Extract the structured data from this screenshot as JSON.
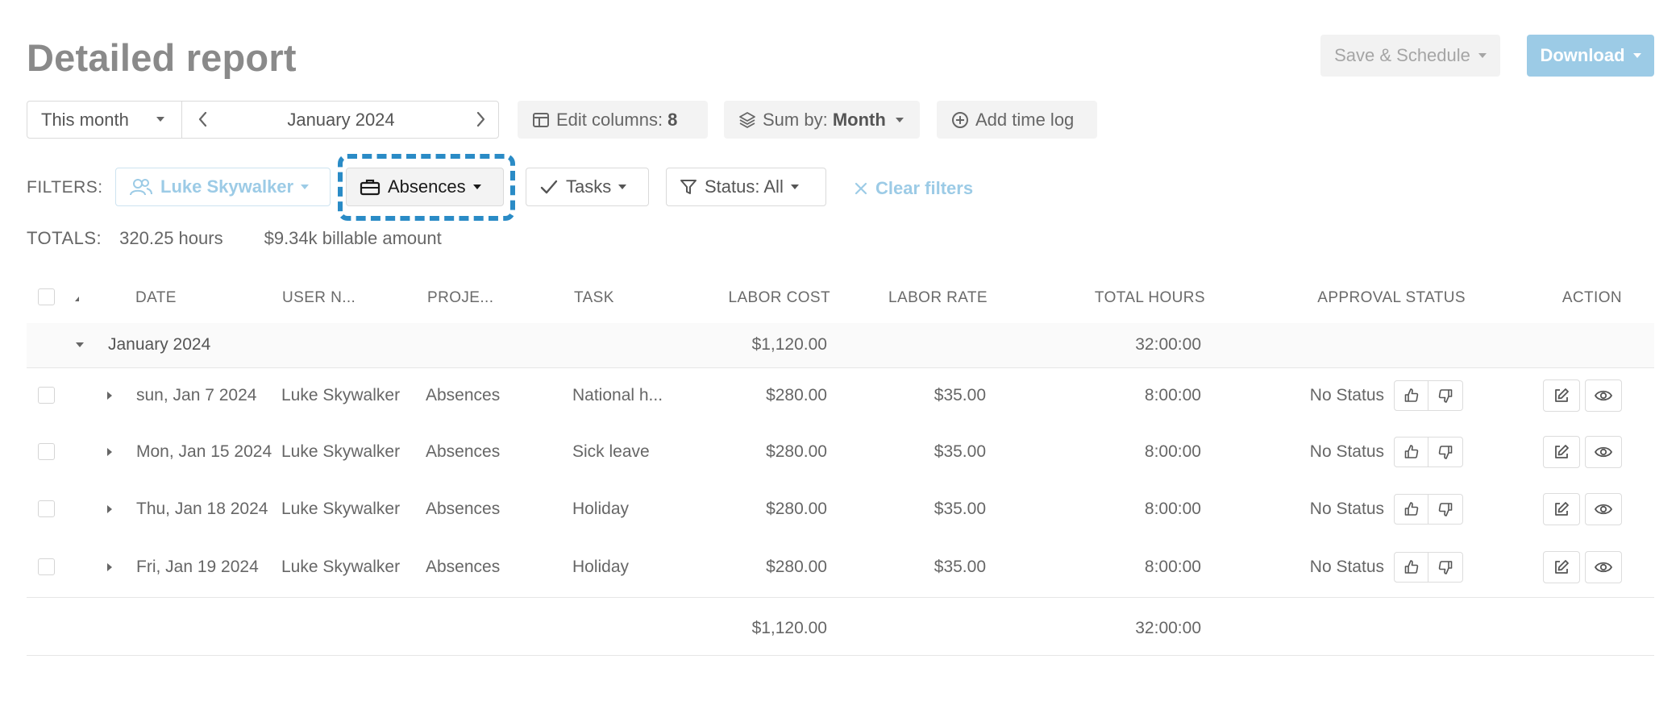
{
  "header": {
    "title": "Detailed report",
    "save_schedule_label": "Save & Schedule",
    "download_label": "Download"
  },
  "toolbar": {
    "range_label": "This month",
    "current_period": "January 2024",
    "edit_columns_prefix": "Edit columns: ",
    "edit_columns_count": "8",
    "sum_by_prefix": "Sum by: ",
    "sum_by_value": "Month",
    "add_time_log_label": "Add time log"
  },
  "filters": {
    "label": "FILTERS:",
    "user": "Luke Skywalker",
    "project": "Absences",
    "tasks": "Tasks",
    "status": "Status: All",
    "clear": "Clear filters"
  },
  "totals": {
    "label": "TOTALS:",
    "hours": "320.25 hours",
    "billable": "$9.34k billable amount"
  },
  "table": {
    "columns": [
      "DATE",
      "USER N...",
      "PROJE...",
      "TASK",
      "LABOR COST",
      "LABOR RATE",
      "TOTAL HOURS",
      "APPROVAL STATUS",
      "ACTION"
    ],
    "group": {
      "label": "January 2024",
      "labor_cost": "$1,120.00",
      "total_hours": "32:00:00"
    },
    "rows": [
      {
        "date": "sun, Jan 7 2024",
        "user": "Luke Skywalker",
        "project": "Absences",
        "task": "National h...",
        "labor_cost": "$280.00",
        "labor_rate": "$35.00",
        "total_hours": "8:00:00",
        "status": "No Status"
      },
      {
        "date": "Mon, Jan 15 2024",
        "user": "Luke Skywalker",
        "project": "Absences",
        "task": "Sick leave",
        "labor_cost": "$280.00",
        "labor_rate": "$35.00",
        "total_hours": "8:00:00",
        "status": "No Status"
      },
      {
        "date": "Thu, Jan 18 2024",
        "user": "Luke Skywalker",
        "project": "Absences",
        "task": "Holiday",
        "labor_cost": "$280.00",
        "labor_rate": "$35.00",
        "total_hours": "8:00:00",
        "status": "No Status"
      },
      {
        "date": "Fri, Jan 19 2024",
        "user": "Luke Skywalker",
        "project": "Absences",
        "task": "Holiday",
        "labor_cost": "$280.00",
        "labor_rate": "$35.00",
        "total_hours": "8:00:00",
        "status": "No Status"
      }
    ],
    "footer": {
      "labor_cost": "$1,120.00",
      "total_hours": "32:00:00"
    }
  },
  "colors": {
    "accent": "#9ccbe6",
    "focus_ring": "#2a8bc6",
    "title": "#8a8a8a"
  },
  "icons": [
    "chevron-left-icon",
    "chevron-right-icon",
    "columns-icon",
    "layers-icon",
    "plus-circle-icon",
    "users-icon",
    "briefcase-icon",
    "check-icon",
    "filter-icon",
    "close-icon",
    "thumbs-up-icon",
    "thumbs-down-icon",
    "edit-icon",
    "eye-icon"
  ]
}
